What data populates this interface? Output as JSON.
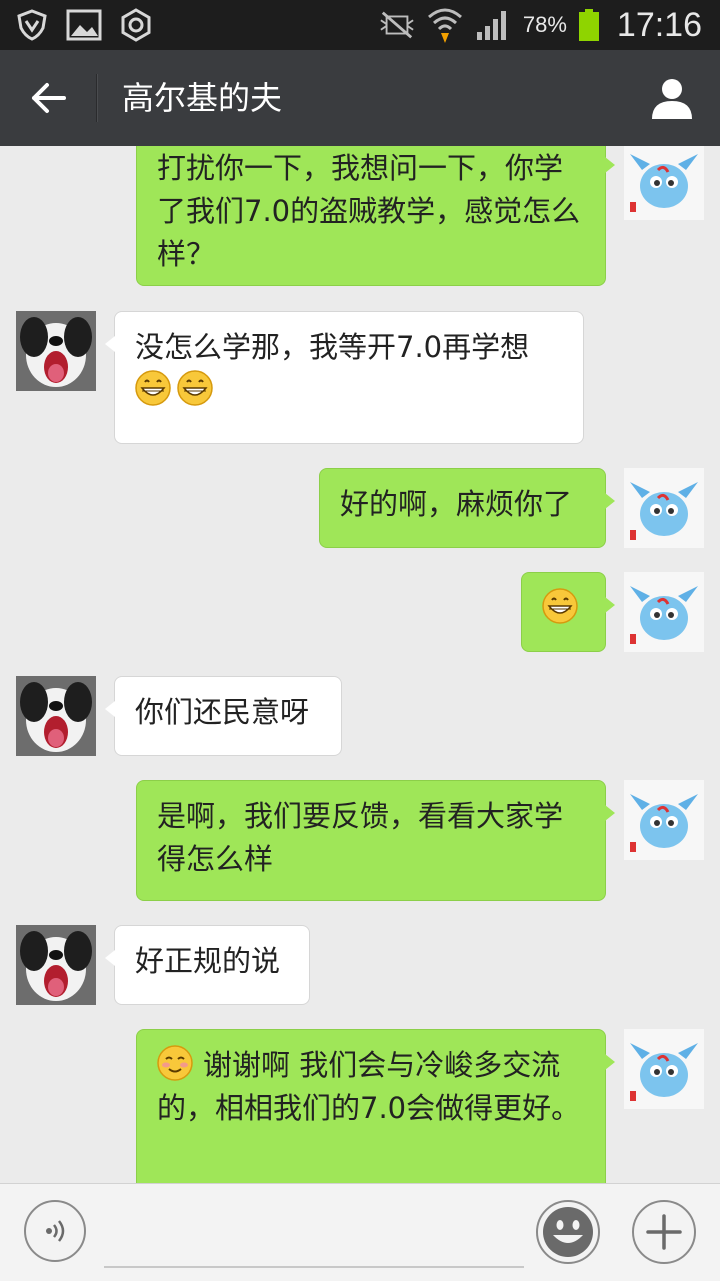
{
  "status_bar": {
    "battery_percent": "78%",
    "time": "17:16",
    "icons": [
      "shield-icon",
      "image-icon",
      "settings-icon",
      "mute-icon",
      "wifi-icon",
      "signal-icon",
      "battery-icon"
    ]
  },
  "header": {
    "title": "高尔基的夫",
    "back_icon": "arrow-left-icon",
    "profile_icon": "person-icon"
  },
  "messages": [
    {
      "sender": "me",
      "text": "打扰你一下，我想问一下，你学了我们7.0的盗贼教学，感觉怎么样？"
    },
    {
      "sender": "them",
      "text": "没怎么学那，我等开7.0再学想",
      "emojis": [
        "grin-emoji",
        "grin-emoji"
      ]
    },
    {
      "sender": "me",
      "text": "好的啊，麻烦你了"
    },
    {
      "sender": "me",
      "text": "",
      "emojis": [
        "grin-emoji"
      ]
    },
    {
      "sender": "them",
      "text": "你们还民意呀"
    },
    {
      "sender": "me",
      "text": "是啊，我们要反馈，看看大家学得怎么样"
    },
    {
      "sender": "them",
      "text": "好正规的说"
    },
    {
      "sender": "me",
      "text": "谢谢啊 我们会与冷峻多交流的，相相我们的7.0会做得更好。",
      "emojis": [
        "blush-emoji"
      ]
    }
  ],
  "input_bar": {
    "placeholder": "",
    "value": "",
    "icons": [
      "voice-icon",
      "smiley-icon",
      "plus-icon"
    ]
  },
  "colors": {
    "status_bar": "#1d1d1d",
    "header": "#3a3c3f",
    "background": "#ebebeb",
    "my_bubble": "#9fe658",
    "their_bubble": "#ffffff",
    "battery": "#8fd400"
  }
}
